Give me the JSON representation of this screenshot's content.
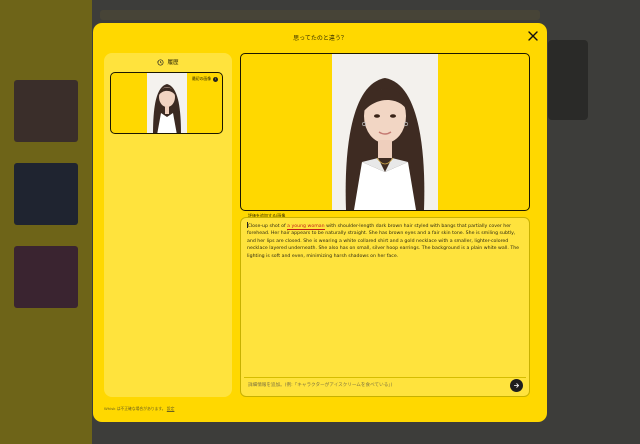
{
  "modal": {
    "title": "思ってたのと違う？",
    "close_icon": "close-icon"
  },
  "history": {
    "heading": "履歴",
    "heading_icon": "history-clock-icon",
    "card_badge": "最初の画像",
    "card_badge_icon": "info-icon"
  },
  "prompt": {
    "label": "評価を追加する/画像",
    "text_before": "Close-up shot of ",
    "text_highlight": "a young woman",
    "text_after": " with shoulder-length dark brown hair styled with bangs that partially cover her forehead. Her hair appears to be naturally straight. She has brown eyes and a fair skin tone. She is smiling subtly, and her lips are closed. She is wearing a white collared shirt and a gold necklace with a smaller, lighter-colored necklace layered underneath. She also has on small, silver hoop earrings. The background is a plain white wall. The lighting is soft and even, minimizing harsh shadows on her face."
  },
  "input": {
    "placeholder": "詳細情報を追加。(例:「キャラクターがアイスクリームを食べている」)",
    "value": "",
    "send_icon": "send-arrow-icon"
  },
  "footer": {
    "text": "Whisk は不正確な場合があります。",
    "link": "設定"
  },
  "colors": {
    "modal_bg": "#ffd800",
    "panel_bg": "#ffe33d",
    "highlight": "#c0201a"
  }
}
